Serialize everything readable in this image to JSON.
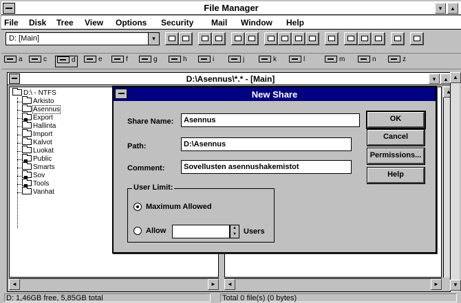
{
  "app": {
    "title": "File Manager",
    "controls": {
      "minimize": "▾",
      "maximize": "▴"
    }
  },
  "menu": [
    "File",
    "Disk",
    "Tree",
    "View",
    "Options",
    "Security",
    "Mail",
    "Window",
    "Help"
  ],
  "toolbar": {
    "drive_select": "D: [Main]",
    "drive_arrow": "▾"
  },
  "drives": [
    {
      "letter": "a",
      "active": false
    },
    {
      "letter": "c",
      "active": false
    },
    {
      "letter": "d",
      "active": true
    },
    {
      "letter": "e",
      "active": false
    },
    {
      "letter": "f",
      "active": false
    },
    {
      "letter": "g",
      "active": false
    },
    {
      "letter": "h",
      "active": false
    },
    {
      "letter": "i",
      "active": false
    },
    {
      "letter": "j",
      "active": false
    },
    {
      "letter": "k",
      "active": false
    },
    {
      "letter": "l",
      "active": false
    },
    {
      "letter": "m",
      "active": false
    },
    {
      "letter": "n",
      "active": false
    },
    {
      "letter": "z",
      "active": false
    }
  ],
  "child_window": {
    "title": "D:\\Asennus\\*.* - [Main]"
  },
  "tree": {
    "root": "D:\\ - NTFS",
    "items": [
      {
        "label": "Arkisto",
        "shared": false
      },
      {
        "label": "Asennus",
        "shared": false,
        "selected": true
      },
      {
        "label": "Export",
        "shared": true
      },
      {
        "label": "Hallinta",
        "shared": false
      },
      {
        "label": "Import",
        "shared": false
      },
      {
        "label": "Kalvot",
        "shared": false
      },
      {
        "label": "Luokat",
        "shared": false
      },
      {
        "label": "Public",
        "shared": true
      },
      {
        "label": "Smarts",
        "shared": false
      },
      {
        "label": "Sov",
        "shared": true
      },
      {
        "label": "Tools",
        "shared": true
      },
      {
        "label": "Vanhat",
        "shared": false
      }
    ]
  },
  "status": {
    "left": "D: 1,46GB free,  5,85GB total",
    "right": "Total 0 file(s) (0 bytes)"
  },
  "dialog": {
    "title": "New Share",
    "share_name_label": "Share Name:",
    "share_name_value": "Asennus",
    "path_label": "Path:",
    "path_value": "D:\\Asennus",
    "comment_label": "Comment:",
    "comment_value": "Sovellusten asennushakemistot",
    "user_limit_label": "User Limit:",
    "max_allowed_label": "Maximum Allowed",
    "allow_label": "Allow",
    "users_label": "Users",
    "allow_value": "",
    "buttons": {
      "ok": "OK",
      "cancel": "Cancel",
      "permissions": "Permissions...",
      "help": "Help"
    }
  }
}
